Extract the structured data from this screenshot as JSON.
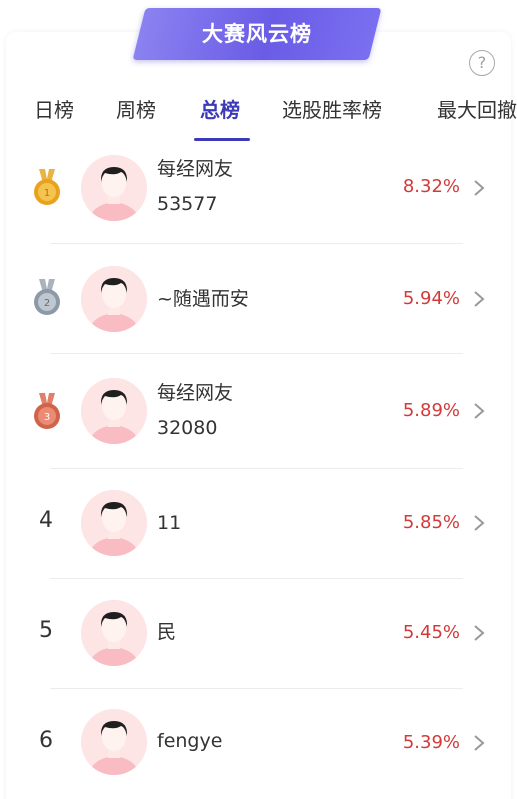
{
  "header": {
    "banner_title": "大赛风云榜",
    "help_glyph": "?"
  },
  "tabs": [
    {
      "label": "日榜",
      "active": false
    },
    {
      "label": "周榜",
      "active": false
    },
    {
      "label": "总榜",
      "active": true
    },
    {
      "label": "选股胜率榜",
      "active": false
    },
    {
      "label": "最大回撤",
      "active": false
    }
  ],
  "rankings": [
    {
      "rank": "1",
      "medal": "gold",
      "name_line1": "每经网友",
      "name_line2": "53577",
      "rate": "8.32%"
    },
    {
      "rank": "2",
      "medal": "silver",
      "name_line1": "~随遇而安",
      "name_line2": "",
      "rate": "5.94%"
    },
    {
      "rank": "3",
      "medal": "bronze",
      "name_line1": "每经网友",
      "name_line2": "32080",
      "rate": "5.89%"
    },
    {
      "rank": "4",
      "medal": "",
      "name_line1": "11",
      "name_line2": "",
      "rate": "5.85%"
    },
    {
      "rank": "5",
      "medal": "",
      "name_line1": "民",
      "name_line2": "",
      "rate": "5.45%"
    },
    {
      "rank": "6",
      "medal": "",
      "name_line1": "fengye",
      "name_line2": "",
      "rate": "5.39%"
    }
  ],
  "colors": {
    "accent": "#3d3ab8",
    "banner": "#6a5ce6",
    "rate": "#d23a3a",
    "gold": "#e8a21f",
    "silver": "#8d99a6",
    "bronze": "#d0634a"
  }
}
